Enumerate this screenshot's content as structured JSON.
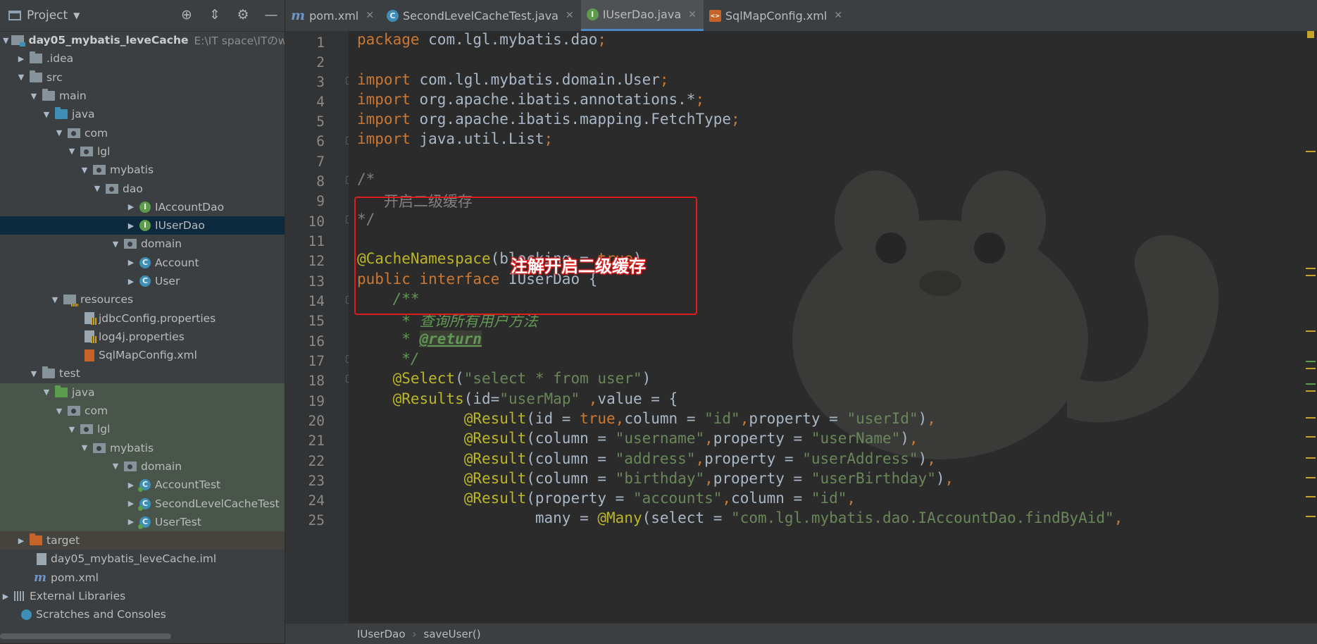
{
  "project_panel": {
    "title": "Project",
    "tools": [
      "locate-icon",
      "collapse-all-icon",
      "gear-icon",
      "minimize-icon"
    ],
    "tree": [
      {
        "label": "day05_mybatis_leveCache",
        "path": "E:\\IT space\\ITのword",
        "icon": "module"
      },
      {
        "label": ".idea",
        "icon": "folder"
      },
      {
        "label": "src",
        "icon": "folder"
      },
      {
        "label": "main",
        "icon": "folder"
      },
      {
        "label": "java",
        "icon": "folder-blue"
      },
      {
        "label": "com",
        "icon": "package"
      },
      {
        "label": "lgl",
        "icon": "package"
      },
      {
        "label": "mybatis",
        "icon": "package"
      },
      {
        "label": "dao",
        "icon": "package"
      },
      {
        "label": "IAccountDao",
        "icon": "interface"
      },
      {
        "label": "IUserDao",
        "icon": "interface"
      },
      {
        "label": "domain",
        "icon": "package"
      },
      {
        "label": "Account",
        "icon": "class"
      },
      {
        "label": "User",
        "icon": "class"
      },
      {
        "label": "resources",
        "icon": "resources"
      },
      {
        "label": "jdbcConfig.properties",
        "icon": "properties-file"
      },
      {
        "label": "log4j.properties",
        "icon": "properties-file"
      },
      {
        "label": "SqlMapConfig.xml",
        "icon": "xml-file"
      },
      {
        "label": "test",
        "icon": "folder"
      },
      {
        "label": "java",
        "icon": "folder-green"
      },
      {
        "label": "com",
        "icon": "package"
      },
      {
        "label": "lgl",
        "icon": "package"
      },
      {
        "label": "mybatis",
        "icon": "package"
      },
      {
        "label": "domain",
        "icon": "package"
      },
      {
        "label": "AccountTest",
        "icon": "test-class"
      },
      {
        "label": "SecondLevelCacheTest",
        "icon": "test-class"
      },
      {
        "label": "UserTest",
        "icon": "test-class"
      },
      {
        "label": "target",
        "icon": "folder-orange"
      },
      {
        "label": "day05_mybatis_leveCache.iml",
        "icon": "iml-file"
      },
      {
        "label": "pom.xml",
        "icon": "maven"
      },
      {
        "label": "External Libraries",
        "icon": "libraries"
      },
      {
        "label": "Scratches and Consoles",
        "icon": "scratches"
      }
    ]
  },
  "tabs": [
    {
      "label": "pom.xml",
      "icon": "maven",
      "active": false
    },
    {
      "label": "SecondLevelCacheTest.java",
      "icon": "class",
      "active": false
    },
    {
      "label": "IUserDao.java",
      "icon": "interface",
      "active": true
    },
    {
      "label": "SqlMapConfig.xml",
      "icon": "xml-file",
      "active": false
    }
  ],
  "line_numbers": [
    "1",
    "2",
    "3",
    "4",
    "5",
    "6",
    "7",
    "8",
    "9",
    "10",
    "11",
    "12",
    "13",
    "14",
    "15",
    "16",
    "17",
    "18",
    "19",
    "20",
    "21",
    "22",
    "23",
    "24",
    "25"
  ],
  "annotation": {
    "label": "注解开启二级缓存",
    "color": "#e01b1b"
  },
  "breadcrumb": [
    "IUserDao",
    "saveUser()"
  ],
  "colors": {
    "keyword": "#cc7832",
    "annotation": "#bbb529",
    "string": "#6a8759",
    "comment": "#808080",
    "javadoc": "#629755",
    "selection": "#0d293e"
  }
}
